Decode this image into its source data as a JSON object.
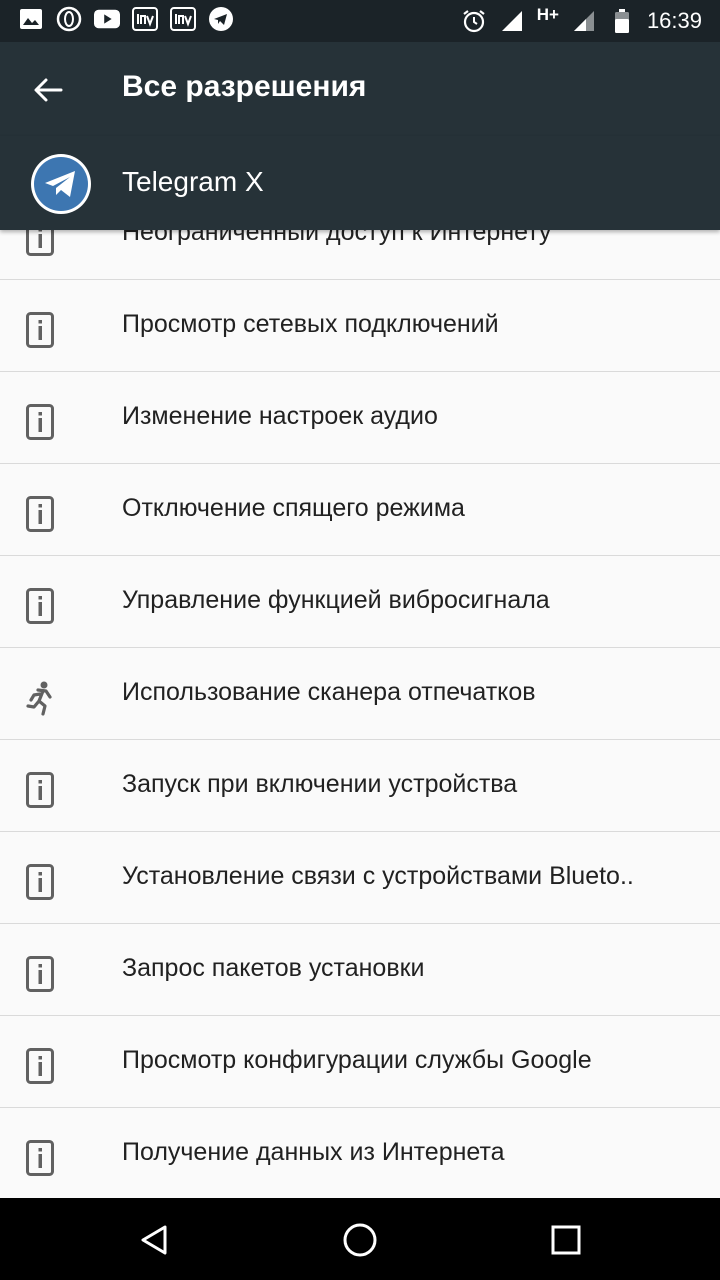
{
  "statusbar": {
    "time": "16:39",
    "network": "H+",
    "notification_icons": [
      "image-icon",
      "opera-icon",
      "youtube-icon",
      "inv-icon",
      "inv-icon",
      "telegram-icon"
    ],
    "status_icons": [
      "alarm-icon",
      "signal-icon",
      "signal-icon",
      "battery-icon"
    ]
  },
  "appbar": {
    "title": "Все разрешения",
    "back_icon": "arrow-back-icon"
  },
  "app": {
    "name": "Telegram X",
    "icon": "telegram-icon"
  },
  "permissions": [
    {
      "label": "Неограниченный доступ к Интернету",
      "icon": "device-info-icon"
    },
    {
      "label": "Просмотр сетевых подключений",
      "icon": "device-info-icon"
    },
    {
      "label": "Изменение настроек аудио",
      "icon": "device-info-icon"
    },
    {
      "label": "Отключение спящего режима",
      "icon": "device-info-icon"
    },
    {
      "label": "Управление функцией вибросигнала",
      "icon": "device-info-icon"
    },
    {
      "label": "Использование сканера отпечатков",
      "icon": "running-person-icon"
    },
    {
      "label": "Запуск при включении устройства",
      "icon": "device-info-icon"
    },
    {
      "label": "Установление связи с устройствами Blueto..",
      "icon": "device-info-icon"
    },
    {
      "label": "Запрос пакетов установки",
      "icon": "device-info-icon"
    },
    {
      "label": "Просмотр конфигурации службы Google",
      "icon": "device-info-icon"
    },
    {
      "label": "Получение данных из Интернета",
      "icon": "device-info-icon"
    }
  ],
  "navbar": {
    "back": "nav-back-icon",
    "home": "nav-home-icon",
    "recents": "nav-recents-icon"
  },
  "colors": {
    "statusbar": "#1b2328",
    "appbar": "#263238",
    "background": "#fafafa",
    "divider": "#dadada",
    "text": "#212121",
    "telegram": "#3d76b1"
  }
}
